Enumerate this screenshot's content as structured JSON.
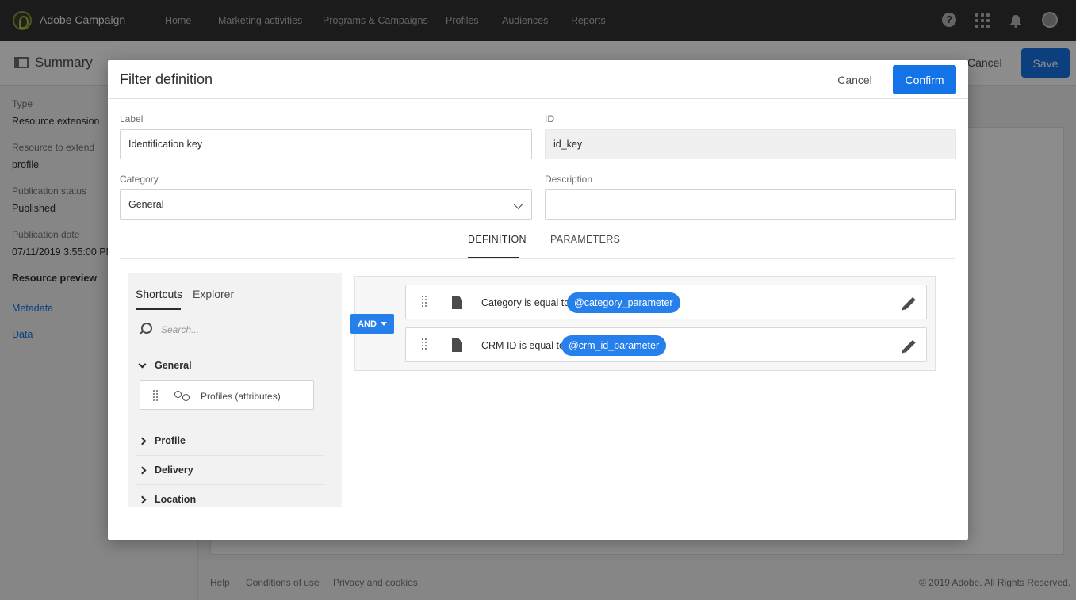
{
  "topbar": {
    "app_name": "Adobe Campaign",
    "nav": [
      "Home",
      "Marketing activities",
      "Programs & Campaigns",
      "Profiles",
      "Audiences",
      "Reports"
    ],
    "help_glyph": "?"
  },
  "background": {
    "summary_title": "Summary",
    "cancel_label": "Cancel",
    "save_label": "Save",
    "sidebar": {
      "type_label": "Type",
      "type_value": "Resource extension",
      "resource_label": "Resource to extend",
      "resource_value": "profile",
      "status_label": "Publication status",
      "status_value": "Published",
      "date_label": "Publication date",
      "date_value": "07/11/2019 3:55:00 PM",
      "preview_head": "Resource preview",
      "link_metadata": "Metadata",
      "link_data": "Data"
    },
    "footer": {
      "help": "Help",
      "conditions": "Conditions of use",
      "privacy": "Privacy and cookies",
      "copyright": "© 2019 Adobe. All Rights Reserved."
    }
  },
  "modal": {
    "title": "Filter definition",
    "cancel_label": "Cancel",
    "confirm_label": "Confirm",
    "label_field": {
      "label": "Label",
      "value": "Identification key"
    },
    "id_field": {
      "label": "ID",
      "value": "id_key"
    },
    "category_field": {
      "label": "Category",
      "value": "General"
    },
    "description_field": {
      "label": "Description",
      "value": ""
    },
    "tabs": {
      "definition": "DEFINITION",
      "parameters": "PARAMETERS"
    },
    "palette": {
      "tab_shortcuts": "Shortcuts",
      "tab_explorer": "Explorer",
      "search_placeholder": "Search...",
      "group_general": "General",
      "item_profiles": "Profiles (attributes)",
      "group_profile": "Profile",
      "group_delivery": "Delivery",
      "group_location": "Location"
    },
    "canvas": {
      "operator": "AND",
      "conditions": [
        {
          "text": "Category is equal to",
          "param": "@category_parameter"
        },
        {
          "text": "CRM ID is equal to",
          "param": "@crm_id_parameter"
        }
      ]
    }
  },
  "colors": {
    "accent": "#1473e6",
    "pill": "#2680eb",
    "topbar": "#323232"
  }
}
